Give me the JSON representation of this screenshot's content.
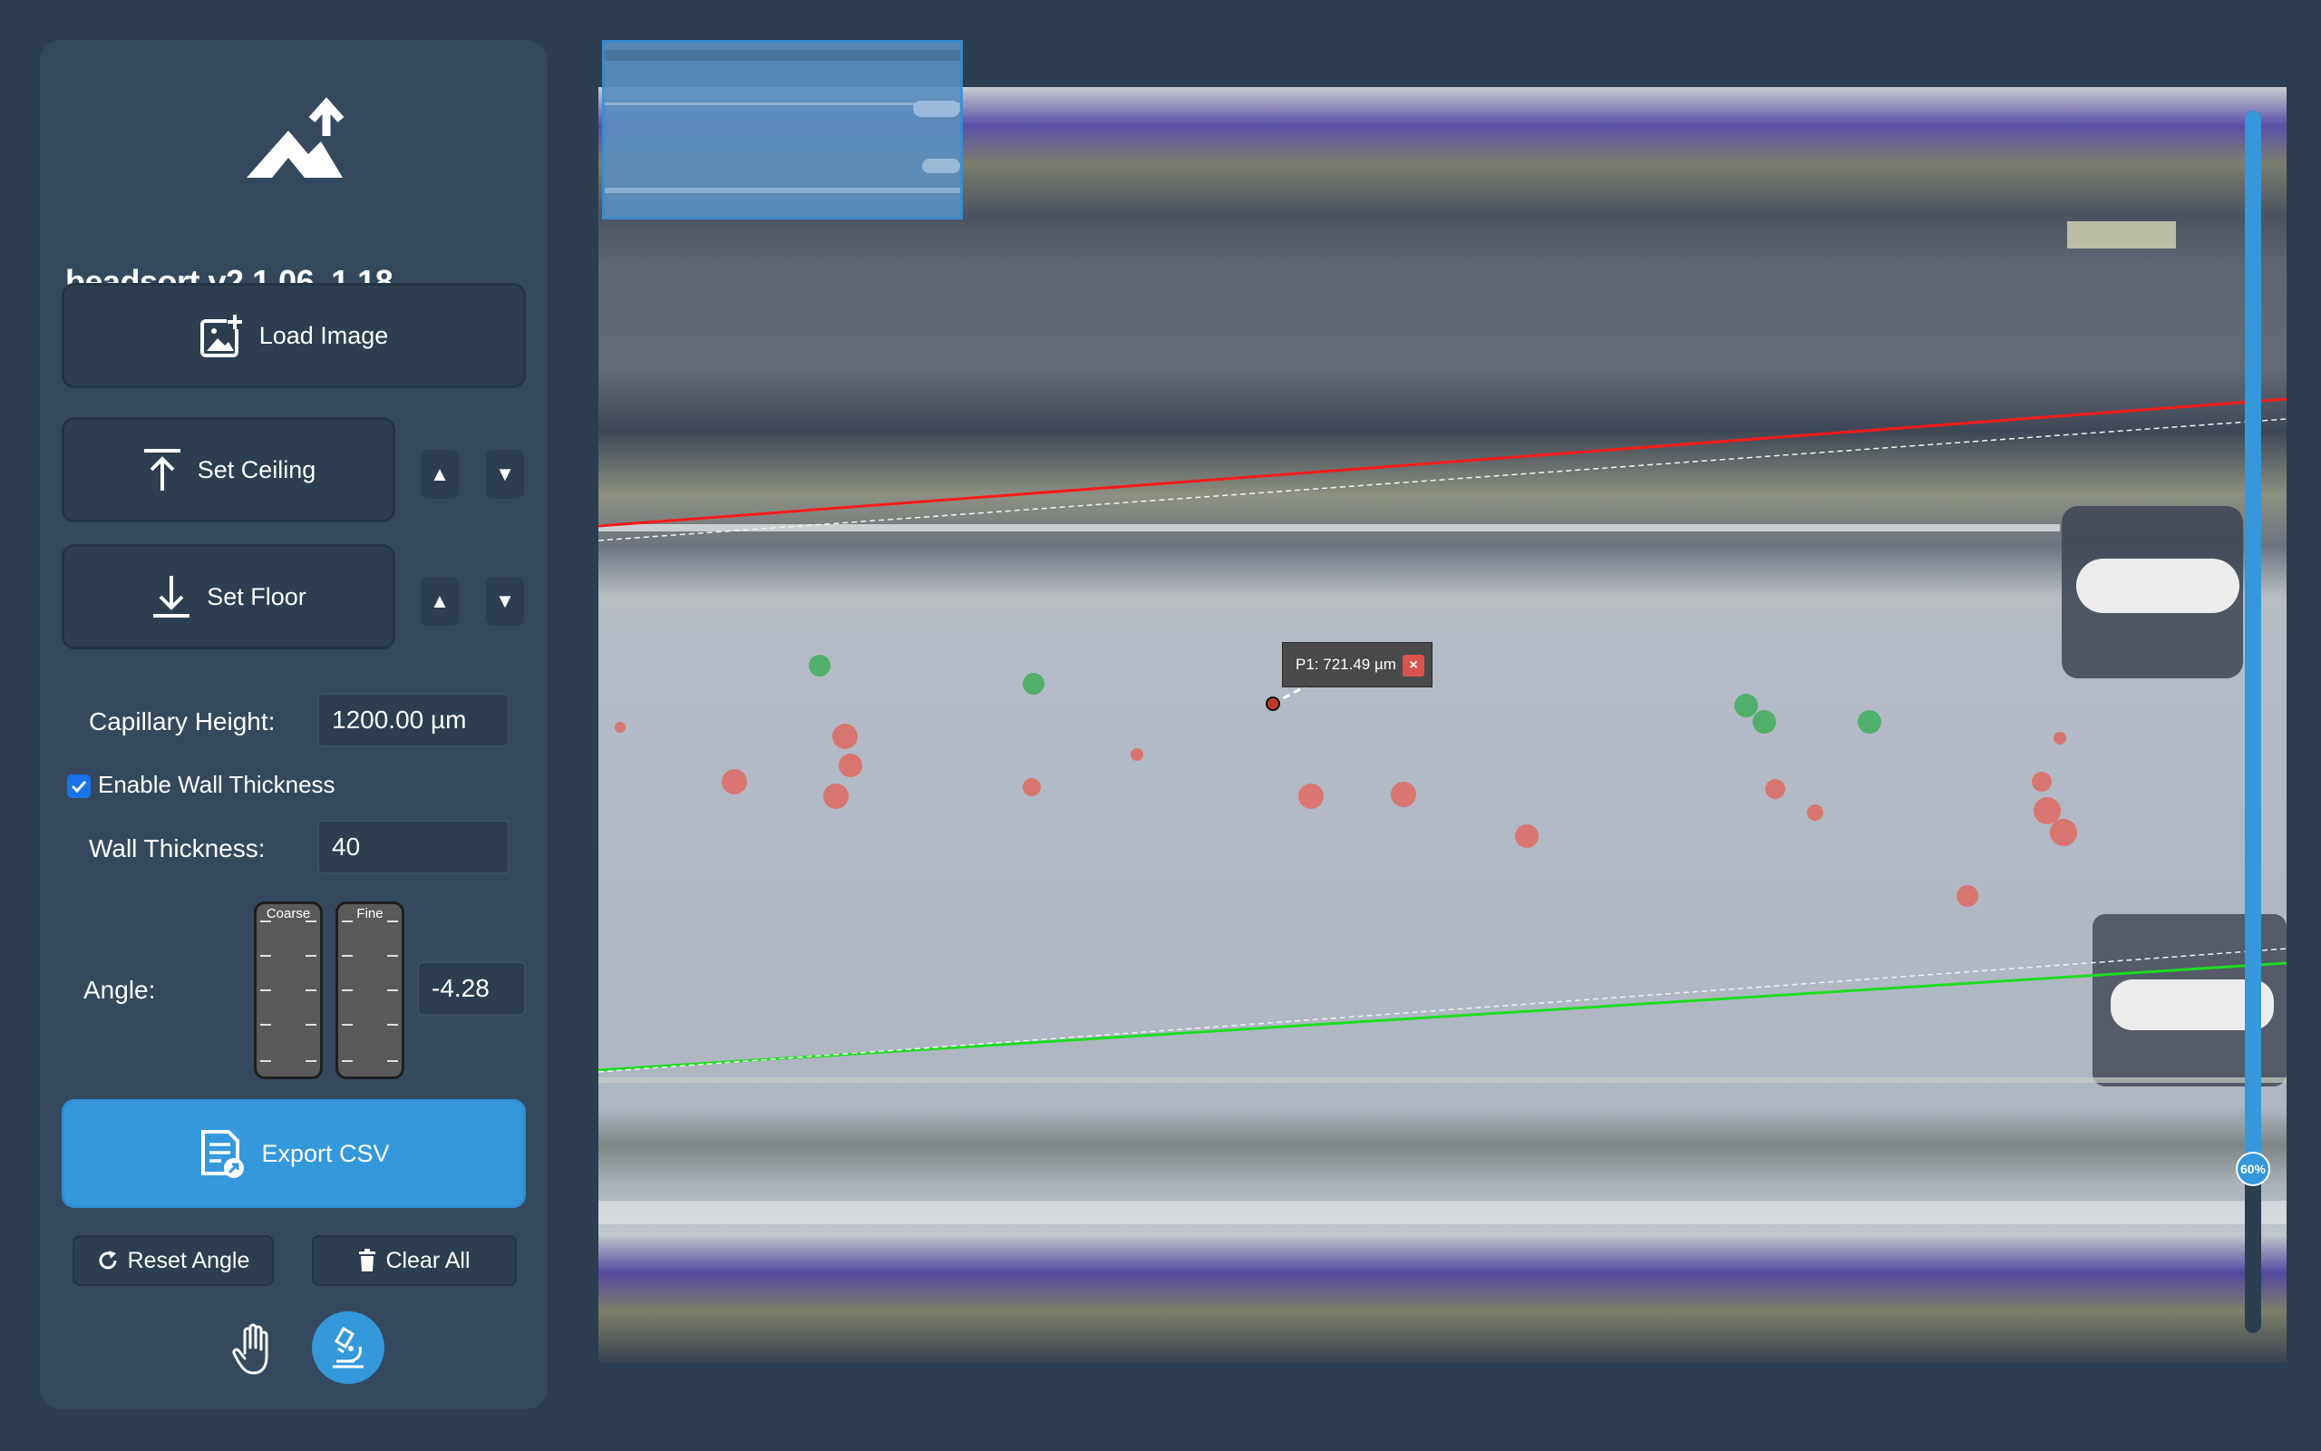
{
  "app": {
    "title": "beadsort v2 1.06, 1.18."
  },
  "sidebar": {
    "load_image_label": "Load Image",
    "set_ceiling_label": "Set Ceiling",
    "set_floor_label": "Set Floor",
    "step_up": "▲",
    "step_down": "▼",
    "capillary_height_label": "Capillary Height:",
    "capillary_height_value": "1200.00 µm",
    "wall_thickness_checkbox_label": "Enable Wall Thickness",
    "wall_thickness_enabled": true,
    "wall_thickness_label": "Wall Thickness:",
    "wall_thickness_value": "40",
    "angle_label": "Angle:",
    "angle_value": "-4.28",
    "coarse_label": "Coarse",
    "fine_label": "Fine",
    "export_csv_label": "Export CSV",
    "reset_angle_label": "Reset Angle",
    "clear_all_label": "Clear All",
    "tools": [
      "hand-icon",
      "microscope-icon"
    ],
    "active_tool": "microscope"
  },
  "viewer": {
    "measurement": {
      "label": "P1: 721.49 µm",
      "close": "×"
    },
    "zoom": {
      "value_percent": 60,
      "label": "60%"
    },
    "ceiling_line_color": "#ff1a1a",
    "floor_line_color": "#22dd22",
    "wall_line_color": "#e8e8e8",
    "bead_colors": {
      "red": "#e06a62",
      "green": "#3fae5a"
    }
  },
  "colors": {
    "background": "#2c3e50",
    "sidebar": "#34495e",
    "accent": "#3498db"
  }
}
